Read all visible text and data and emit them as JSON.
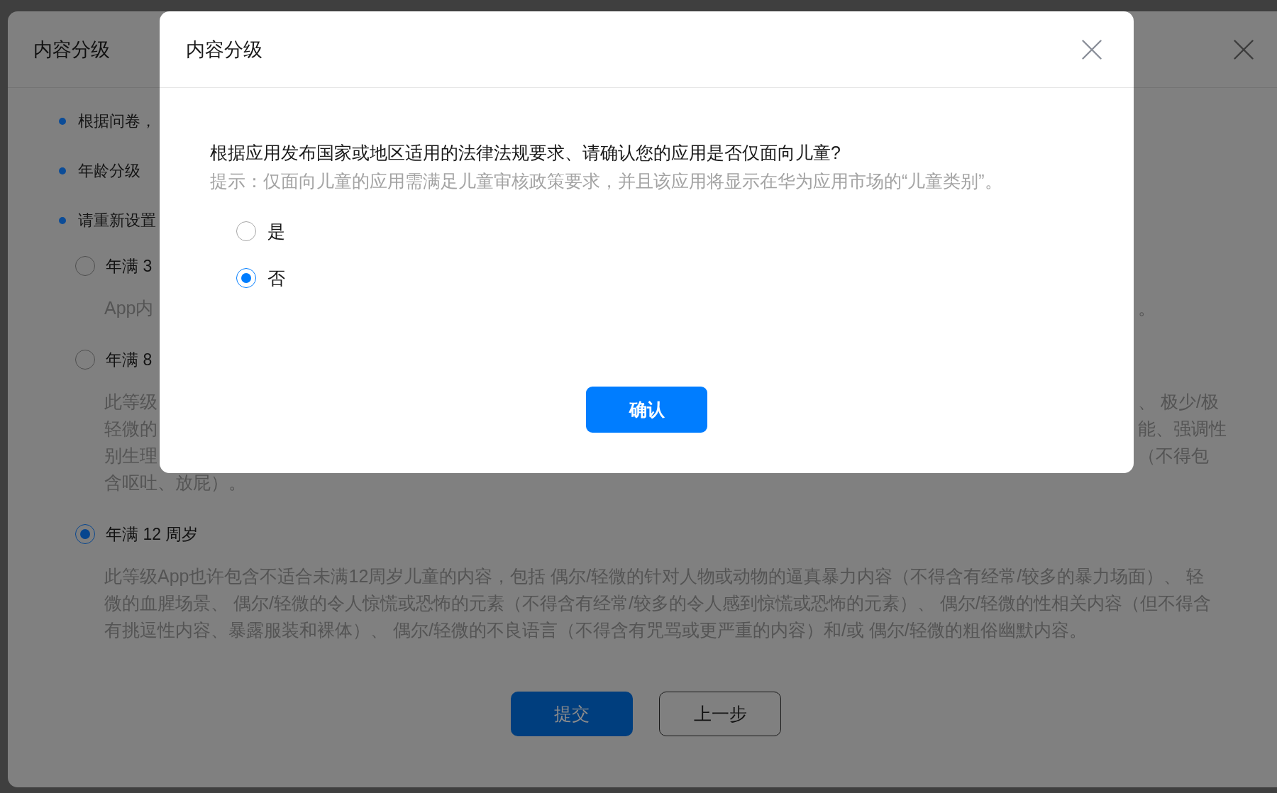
{
  "background_dialog": {
    "title": "内容分级",
    "notes": [
      "根据问卷，",
      "年龄分级",
      "请重新设置"
    ],
    "ratings": [
      {
        "label": "年满 3",
        "selected": false,
        "description_lines": [
          {
            "left": "App内",
            "right": "。"
          }
        ]
      },
      {
        "label": "年满 8",
        "selected": false,
        "description_lines": [
          {
            "left": "此等级",
            "right": "、 极少/极"
          },
          {
            "left": "轻微的",
            "right": "能、强调性"
          },
          {
            "left": "别生理",
            "right": "（不得包"
          },
          {
            "left": "含呕吐、放屁）。"
          }
        ]
      },
      {
        "label": "年满 12 周岁",
        "selected": true,
        "description": "此等级App也许包含不适合未满12周岁儿童的内容，包括 偶尔/轻微的针对人物或动物的逼真暴力内容（不得含有经常/较多的暴力场面）、 轻微的血腥场景、 偶尔/轻微的令人惊慌或恐怖的元素（不得含有经常/较多的令人感到惊慌或恐怖的元素）、 偶尔/轻微的性相关内容（但不得含有挑逗性内容、暴露服装和裸体）、 偶尔/轻微的不良语言（不得含有咒骂或更严重的内容）和/或 偶尔/轻微的粗俗幽默内容。"
      }
    ],
    "buttons": [
      {
        "label": "提交",
        "kind": "primary"
      },
      {
        "label": "上一步",
        "kind": "secondary"
      }
    ]
  },
  "modal": {
    "title": "内容分级",
    "question": "根据应用发布国家或地区适用的法律法规要求、请确认您的应用是否仅面向儿童?",
    "hint": "提示：仅面向儿童的应用需满足儿童审核政策要求，并且该应用将显示在华为应用市场的“儿童类别”。",
    "options": [
      {
        "label": "是",
        "selected": false
      },
      {
        "label": "否",
        "selected": true
      }
    ],
    "confirm_button": "确认"
  }
}
